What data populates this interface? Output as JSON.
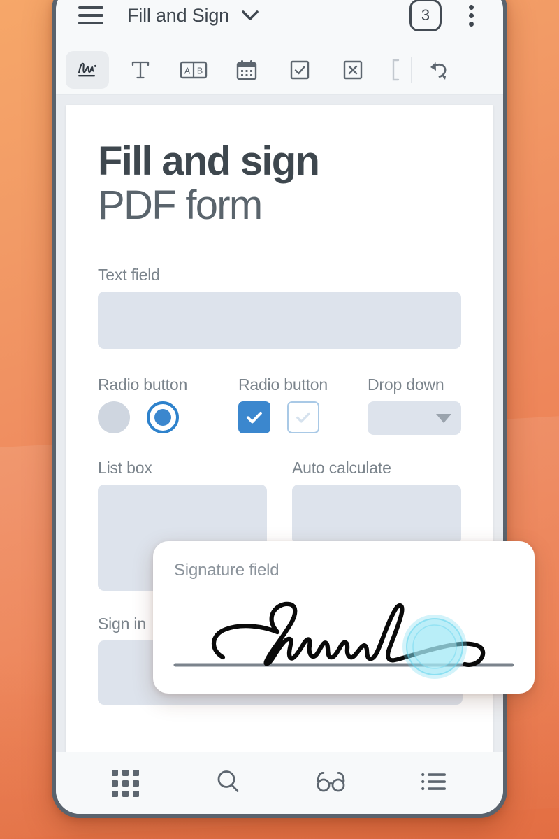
{
  "theme": {
    "accent_blue": "#3b87ce",
    "field_fill": "#dde3ec",
    "background_orange": "#ef8b5c",
    "text_dark": "#3f474f",
    "label_gray": "#7b848c",
    "ripple_cyan": "#8fe4f2"
  },
  "appbar": {
    "menu_icon": "hamburger-menu-icon",
    "title": "Fill and Sign",
    "title_caret_icon": "chevron-down-icon",
    "page_badge": "3",
    "overflow_icon": "kebab-menu-icon"
  },
  "toolbar": {
    "tools": [
      {
        "name": "signature-tool",
        "icon": "signature-icon",
        "label": "Signature",
        "selected": true
      },
      {
        "name": "text-tool",
        "icon": "text-t-icon",
        "label": "Text",
        "selected": false
      },
      {
        "name": "combo-tool",
        "icon": "ab-combo-icon",
        "label": "A B",
        "selected": false
      },
      {
        "name": "date-tool",
        "icon": "calendar-icon",
        "label": "Date",
        "selected": false
      },
      {
        "name": "checkmark-tool",
        "icon": "checkbox-check-icon",
        "label": "Checkmark",
        "selected": false
      },
      {
        "name": "cross-tool",
        "icon": "checkbox-cross-icon",
        "label": "Cross",
        "selected": false
      },
      {
        "name": "bracket-tool",
        "icon": "bracket-icon",
        "label": "Bracket",
        "selected": false
      },
      {
        "name": "undo-tool",
        "icon": "undo-arrow-icon",
        "label": "Undo",
        "selected": false
      }
    ]
  },
  "document": {
    "title": "Fill and sign",
    "subtitle": "PDF form",
    "fields": {
      "text_field": {
        "label": "Text field",
        "value": ""
      },
      "radio_group_1": {
        "label": "Radio button",
        "options": [
          {
            "name": "radio-unselected",
            "selected": false
          },
          {
            "name": "radio-selected",
            "selected": true
          }
        ]
      },
      "radio_group_2": {
        "label": "Radio button",
        "options": [
          {
            "name": "checkbox-checked",
            "selected": true
          },
          {
            "name": "checkbox-unchecked",
            "selected": false
          }
        ]
      },
      "drop_down": {
        "label": "Drop down",
        "value": "",
        "caret_icon": "caret-down-icon"
      },
      "list_box": {
        "label": "List box",
        "value": ""
      },
      "auto_calculate": {
        "label": "Auto calculate",
        "value": ""
      },
      "sign_in": {
        "label": "Sign in",
        "value": ""
      }
    }
  },
  "signature_card": {
    "label": "Signature field",
    "signature_alt": "handwritten-cursive-signature",
    "ripple_alt": "touch-ripple-indicator"
  },
  "bottomnav": {
    "items": [
      {
        "name": "nav-thumbnails",
        "icon": "grid-dots-icon",
        "label": "Thumbnails"
      },
      {
        "name": "nav-search",
        "icon": "search-icon",
        "label": "Search"
      },
      {
        "name": "nav-reading-mode",
        "icon": "glasses-icon",
        "label": "Reading mode"
      },
      {
        "name": "nav-outline",
        "icon": "list-outline-icon",
        "label": "Outline"
      }
    ]
  }
}
